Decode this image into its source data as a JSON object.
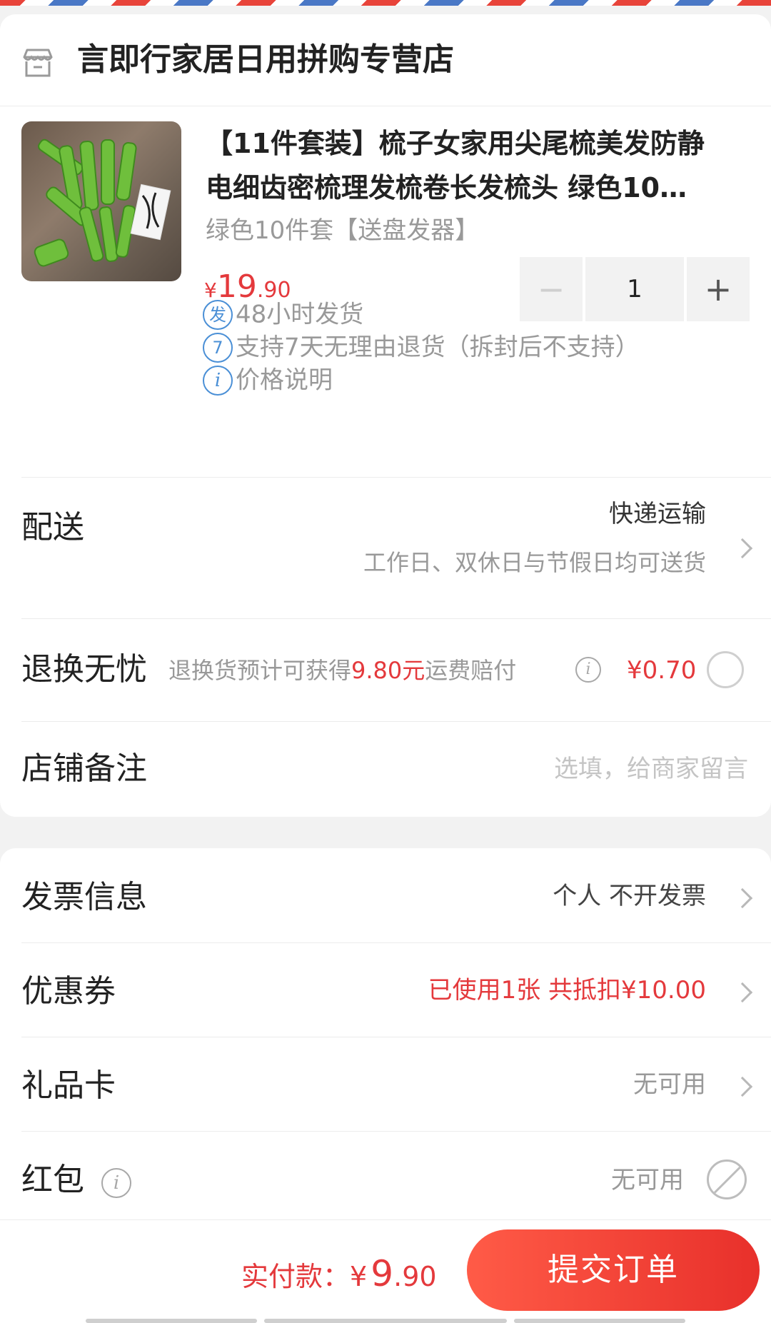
{
  "shop": {
    "name": "言即行家居日用拼购专营店",
    "icon": "store-icon"
  },
  "product": {
    "title_line1": "【11件套装】梳子女家用尖尾梳美发防静",
    "title_line2": "电细齿密梳理发梳卷长发梳头 绿色10…",
    "sku": "绿色10件套【送盘发器】",
    "price_symbol": "¥",
    "price_integer": "19",
    "price_decimal": ".90",
    "quantity": "1",
    "minus": "−",
    "plus": "+"
  },
  "services": [
    {
      "badge": "发",
      "text": "48小时发货"
    },
    {
      "badge": "7",
      "text": "支持7天无理由退货（拆封后不支持）"
    },
    {
      "badge": "i",
      "text": "价格说明"
    }
  ],
  "delivery": {
    "label": "配送",
    "method": "快递运输",
    "note": "工作日、双休日与节假日均可送货"
  },
  "exchange": {
    "label": "退换无忧",
    "desc_prefix": "退换货预计可获得",
    "desc_amount": "9.80元",
    "desc_suffix": "运费赔付",
    "info": "i",
    "price": "¥0.70"
  },
  "remark": {
    "label": "店铺备注",
    "placeholder": "选填，给商家留言"
  },
  "invoice": {
    "label": "发票信息",
    "value": "个人 不开发票"
  },
  "coupon": {
    "label": "优惠券",
    "value": "已使用1张 共抵扣¥10.00"
  },
  "gift_card": {
    "label": "礼品卡",
    "value": "无可用"
  },
  "red_packet": {
    "label": "红包",
    "info": "i",
    "value": "无可用"
  },
  "footer": {
    "pay_label": "实付款：",
    "pay_symbol": "¥",
    "pay_integer": "9",
    "pay_decimal": ".90",
    "submit": "提交订单"
  },
  "colors": {
    "accent": "#e4393c",
    "badge": "#4a8fd6",
    "muted": "#999999"
  }
}
